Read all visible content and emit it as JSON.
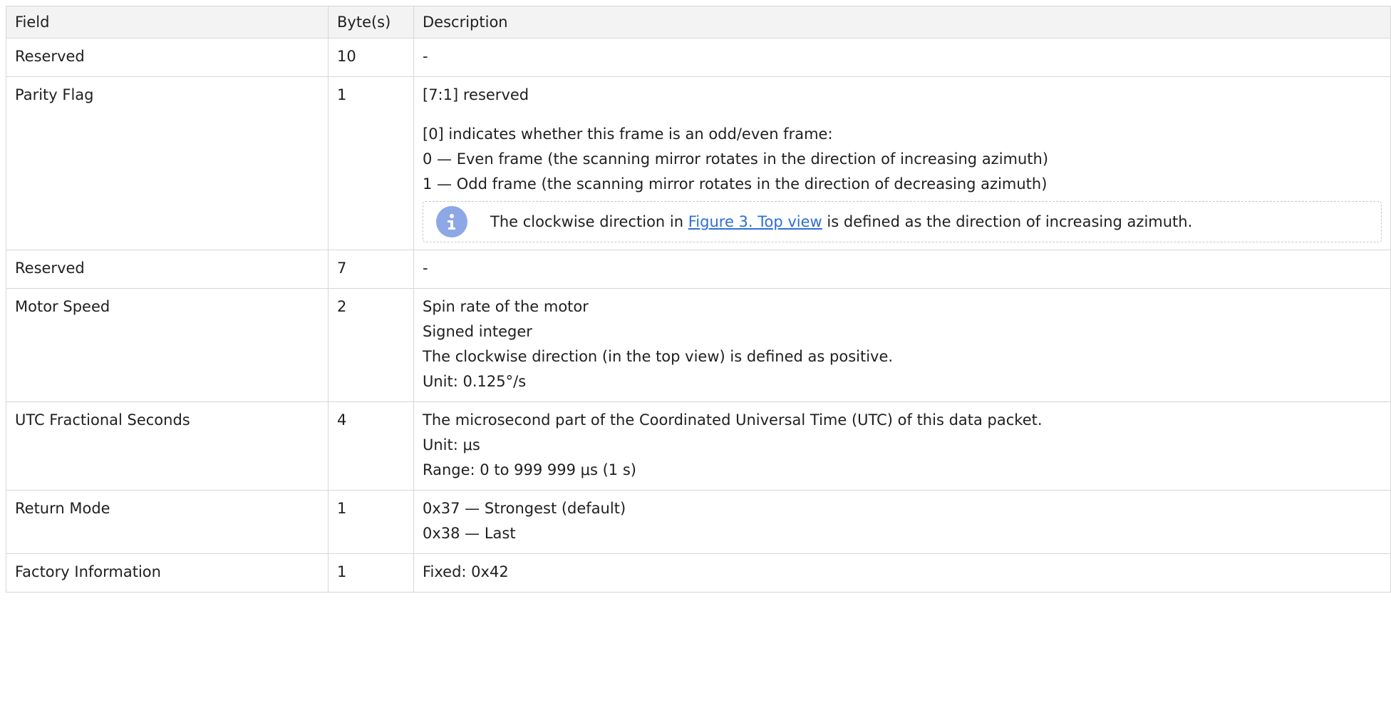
{
  "table": {
    "headers": {
      "field": "Field",
      "bytes": "Byte(s)",
      "description": "Description"
    },
    "rows": [
      {
        "field": "Reserved",
        "bytes": "10",
        "desc": [
          "-"
        ]
      },
      {
        "field": "Parity Flag",
        "bytes": "1",
        "desc_intro": "[7:1] reserved",
        "desc": [
          "[0] indicates whether this frame is an odd/even frame:",
          "0 — Even frame (the scanning mirror rotates in the direction of increasing azimuth)",
          "1 — Odd frame (the scanning mirror rotates in the direction of decreasing azimuth)"
        ],
        "note": {
          "icon": "info-icon",
          "before": "The clockwise direction in ",
          "link": "Figure 3. Top view",
          "after": " is defined as the direction of increasing azimuth."
        }
      },
      {
        "field": "Reserved",
        "bytes": "7",
        "desc": [
          "-"
        ]
      },
      {
        "field": "Motor Speed",
        "bytes": "2",
        "desc": [
          "Spin rate of the motor",
          "Signed integer",
          "The clockwise direction (in the top view) is defined as positive.",
          "Unit: 0.125°/s"
        ]
      },
      {
        "field": "UTC Fractional Seconds",
        "bytes": "4",
        "desc": [
          "The microsecond part of the Coordinated Universal Time (UTC) of this data packet.",
          "Unit: μs",
          "Range: 0 to 999 999 μs (1 s)"
        ]
      },
      {
        "field": "Return Mode",
        "bytes": "1",
        "desc": [
          "0x37 — Strongest (default)",
          "0x38 — Last"
        ]
      },
      {
        "field": "Factory Information",
        "bytes": "1",
        "desc": [
          "Fixed: 0x42"
        ]
      }
    ]
  }
}
